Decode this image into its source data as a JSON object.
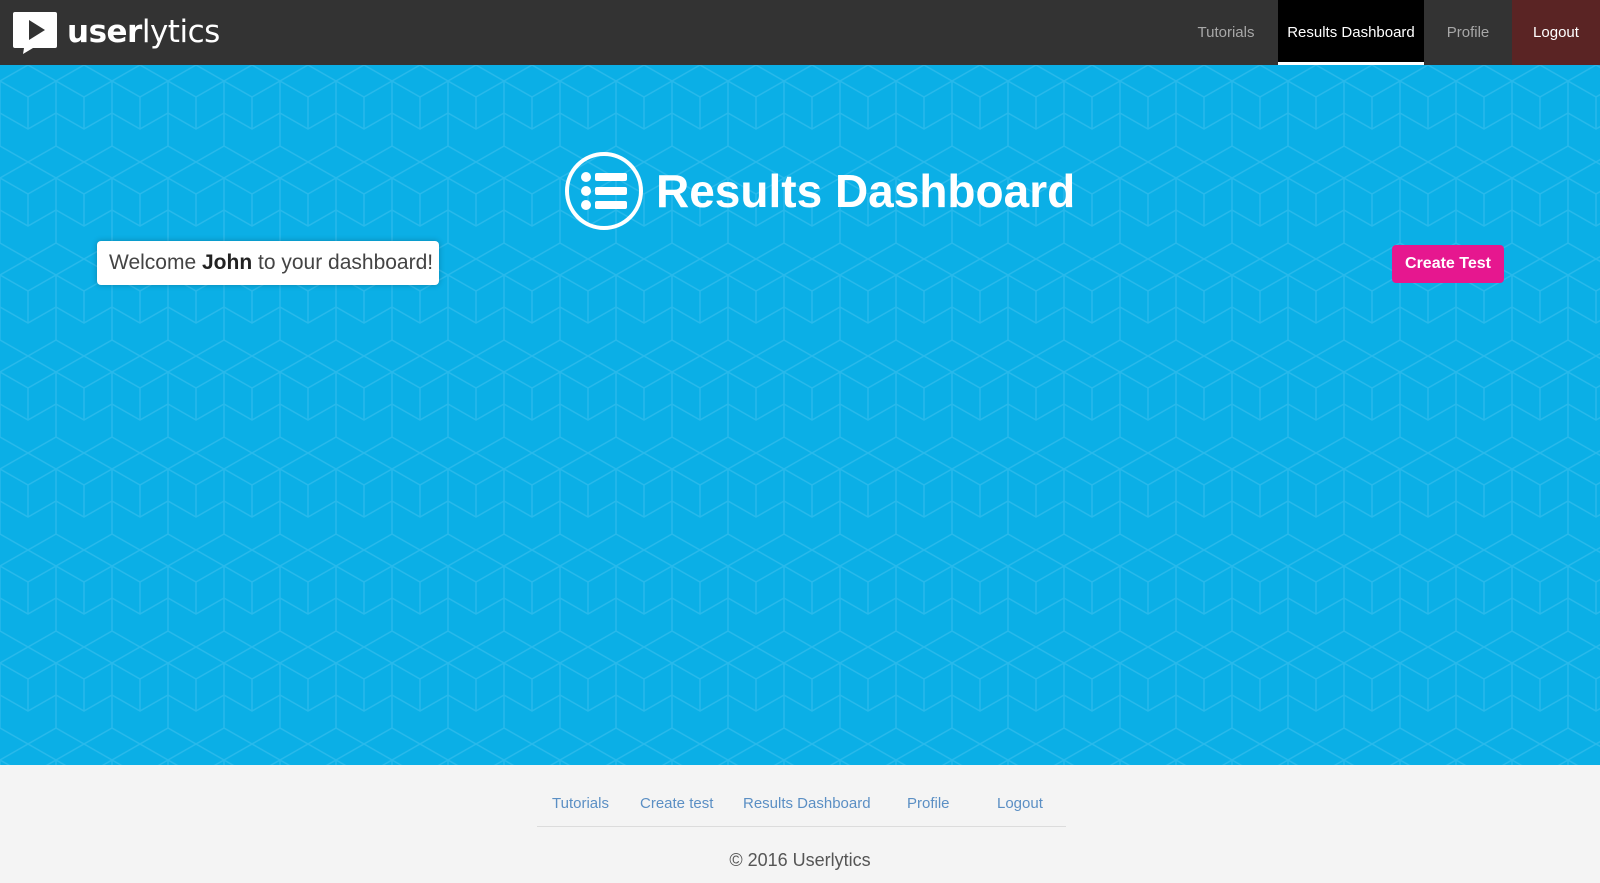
{
  "brand": {
    "name_bold": "user",
    "name_light": "lytics",
    "logo_icon": "play-icon"
  },
  "nav": {
    "tutorials": "Tutorials",
    "results_dashboard": "Results Dashboard",
    "profile": "Profile",
    "logout": "Logout",
    "active": "Results Dashboard"
  },
  "hero": {
    "title": "Results Dashboard",
    "title_icon": "list-icon",
    "welcome_prefix": "Welcome ",
    "welcome_name": "John",
    "welcome_suffix": " to your dashboard!",
    "create_button": "Create Test"
  },
  "footer": {
    "links": [
      "Tutorials",
      "Create test",
      "Results Dashboard",
      "Profile",
      "Logout"
    ],
    "copyright": "© 2016 Userlytics"
  },
  "colors": {
    "topbar": "#333333",
    "hero": "#0bafe6",
    "create_button": "#e6178f",
    "logout_bg": "#5a2424",
    "footer_link": "#5b8fc4"
  }
}
